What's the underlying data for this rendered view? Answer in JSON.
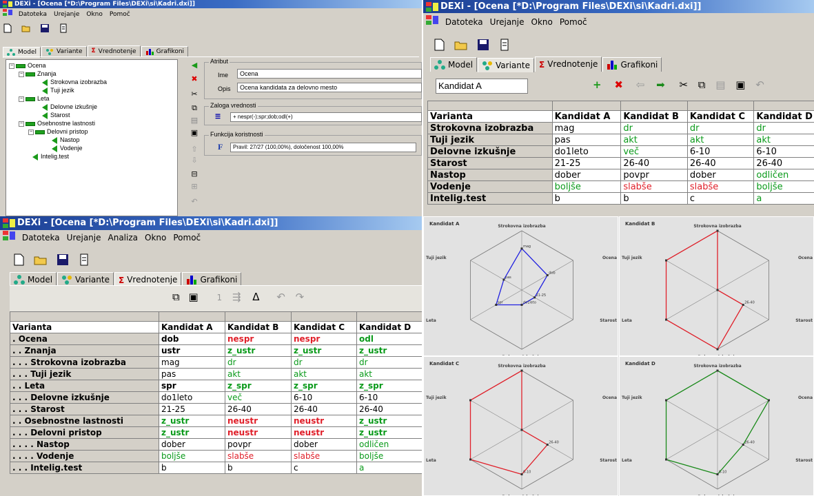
{
  "window_title_short": "DEXi - [Ocena [*D:\\Program Files\\DEXi\\si\\Kadri.dxi]]",
  "window_title": "DEXi - [Ocena [*D:\\Program Files\\DEXi\\si\\Kadri.dxi]]",
  "menus": {
    "basic": [
      "Datoteka",
      "Urejanje",
      "Okno",
      "Pomoč"
    ],
    "with_analysis": [
      "Datoteka",
      "Urejanje",
      "Analiza",
      "Okno",
      "Pomoč"
    ]
  },
  "tabs": [
    "Model",
    "Variante",
    "Vrednotenje",
    "Grafikoni"
  ],
  "model_window": {
    "tree": [
      {
        "label": "Ocena",
        "level": 0,
        "type": "aggregate",
        "expander": "−"
      },
      {
        "label": "Znanja",
        "level": 1,
        "type": "aggregate",
        "expander": "−"
      },
      {
        "label": "Strokovna izobrazba",
        "level": 2,
        "type": "basic"
      },
      {
        "label": "Tuji jezik",
        "level": 2,
        "type": "basic"
      },
      {
        "label": "Leta",
        "level": 1,
        "type": "aggregate",
        "expander": "−"
      },
      {
        "label": "Delovne izkušnje",
        "level": 2,
        "type": "basic"
      },
      {
        "label": "Starost",
        "level": 2,
        "type": "basic"
      },
      {
        "label": "Osebnostne lastnosti",
        "level": 1,
        "type": "aggregate",
        "expander": "−"
      },
      {
        "label": "Delovni pristop",
        "level": 2,
        "type": "aggregate",
        "expander": "−"
      },
      {
        "label": "Nastop",
        "level": 3,
        "type": "basic"
      },
      {
        "label": "Vodenje",
        "level": 3,
        "type": "basic"
      },
      {
        "label": "Intelig.test",
        "level": 1,
        "type": "basic"
      }
    ],
    "attribute_group": "Atribut",
    "name_label": "Ime",
    "name_value": "Ocena",
    "desc_label": "Opis",
    "desc_value": "Ocena kandidata za delovno mesto",
    "scale_group": "Zaloga vrednosti",
    "scale_value": "+ nespr(-);spr;dob;odl(+)",
    "function_group": "Funkcija koristnosti",
    "function_value": "Pravil: 27/27 (100,00%), določenost 100,00%",
    "function_icon": "F"
  },
  "variants_window": {
    "current_variant": "Kandidat A",
    "header": [
      "Varianta",
      "Kandidat A",
      "Kandidat B",
      "Kandidat C",
      "Kandidat D"
    ],
    "rows": [
      {
        "label": "Strokovna izobrazba",
        "cells": [
          [
            "mag",
            "black"
          ],
          [
            "dr",
            "green"
          ],
          [
            "dr",
            "green"
          ],
          [
            "dr",
            "green"
          ]
        ]
      },
      {
        "label": "Tuji jezik",
        "cells": [
          [
            "pas",
            "black"
          ],
          [
            "akt",
            "green"
          ],
          [
            "akt",
            "green"
          ],
          [
            "akt",
            "green"
          ]
        ]
      },
      {
        "label": "Delovne izkušnje",
        "cells": [
          [
            "do1leto",
            "black"
          ],
          [
            "več",
            "green"
          ],
          [
            "6-10",
            "black"
          ],
          [
            "6-10",
            "black"
          ]
        ]
      },
      {
        "label": "Starost",
        "cells": [
          [
            "21-25",
            "black"
          ],
          [
            "26-40",
            "black"
          ],
          [
            "26-40",
            "black"
          ],
          [
            "26-40",
            "black"
          ]
        ]
      },
      {
        "label": "Nastop",
        "cells": [
          [
            "dober",
            "black"
          ],
          [
            "povpr",
            "black"
          ],
          [
            "dober",
            "black"
          ],
          [
            "odličen",
            "green"
          ]
        ]
      },
      {
        "label": "Vodenje",
        "cells": [
          [
            "boljše",
            "green"
          ],
          [
            "slabše",
            "red"
          ],
          [
            "slabše",
            "red"
          ],
          [
            "boljše",
            "green"
          ]
        ]
      },
      {
        "label": "Intelig.test",
        "cells": [
          [
            "b",
            "black"
          ],
          [
            "b",
            "black"
          ],
          [
            "c",
            "black"
          ],
          [
            "a",
            "green"
          ]
        ]
      }
    ]
  },
  "evaluation_window": {
    "header": [
      "Varianta",
      "Kandidat A",
      "Kandidat B",
      "Kandidat C",
      "Kandidat D"
    ],
    "rows": [
      {
        "label": ". Ocena",
        "bold": true,
        "cells": [
          [
            "dob",
            "black"
          ],
          [
            "nespr",
            "red"
          ],
          [
            "nespr",
            "red"
          ],
          [
            "odl",
            "green"
          ]
        ]
      },
      {
        "label": ". . Znanja",
        "bold": true,
        "cells": [
          [
            "ustr",
            "black"
          ],
          [
            "z_ustr",
            "green"
          ],
          [
            "z_ustr",
            "green"
          ],
          [
            "z_ustr",
            "green"
          ]
        ]
      },
      {
        "label": ". . . Strokovna izobrazba",
        "bold": false,
        "cells": [
          [
            "mag",
            "black"
          ],
          [
            "dr",
            "green"
          ],
          [
            "dr",
            "green"
          ],
          [
            "dr",
            "green"
          ]
        ]
      },
      {
        "label": ". . . Tuji jezik",
        "bold": false,
        "cells": [
          [
            "pas",
            "black"
          ],
          [
            "akt",
            "green"
          ],
          [
            "akt",
            "green"
          ],
          [
            "akt",
            "green"
          ]
        ]
      },
      {
        "label": ". . Leta",
        "bold": true,
        "cells": [
          [
            "spr",
            "black"
          ],
          [
            "z_spr",
            "green"
          ],
          [
            "z_spr",
            "green"
          ],
          [
            "z_spr",
            "green"
          ]
        ]
      },
      {
        "label": ". . . Delovne izkušnje",
        "bold": false,
        "cells": [
          [
            "do1leto",
            "black"
          ],
          [
            "več",
            "green"
          ],
          [
            "6-10",
            "black"
          ],
          [
            "6-10",
            "black"
          ]
        ]
      },
      {
        "label": ". . . Starost",
        "bold": false,
        "cells": [
          [
            "21-25",
            "black"
          ],
          [
            "26-40",
            "black"
          ],
          [
            "26-40",
            "black"
          ],
          [
            "26-40",
            "black"
          ]
        ]
      },
      {
        "label": ". . Osebnostne lastnosti",
        "bold": true,
        "cells": [
          [
            "z_ustr",
            "green"
          ],
          [
            "neustr",
            "red"
          ],
          [
            "neustr",
            "red"
          ],
          [
            "z_ustr",
            "green"
          ]
        ]
      },
      {
        "label": ". . . Delovni pristop",
        "bold": true,
        "cells": [
          [
            "z_ustr",
            "green"
          ],
          [
            "neustr",
            "red"
          ],
          [
            "neustr",
            "red"
          ],
          [
            "z_ustr",
            "green"
          ]
        ]
      },
      {
        "label": ". . . . Nastop",
        "bold": false,
        "cells": [
          [
            "dober",
            "black"
          ],
          [
            "povpr",
            "black"
          ],
          [
            "dober",
            "black"
          ],
          [
            "odličen",
            "green"
          ]
        ]
      },
      {
        "label": ". . . . Vodenje",
        "bold": false,
        "cells": [
          [
            "boljše",
            "green"
          ],
          [
            "slabše",
            "red"
          ],
          [
            "slabše",
            "red"
          ],
          [
            "boljše",
            "green"
          ]
        ]
      },
      {
        "label": ". . . Intelig.test",
        "bold": false,
        "cells": [
          [
            "b",
            "black"
          ],
          [
            "b",
            "black"
          ],
          [
            "c",
            "black"
          ],
          [
            "a",
            "green"
          ]
        ]
      }
    ]
  },
  "colors": {
    "black": "#000000",
    "green": "#0a9a1a",
    "red": "#e0202a",
    "blue": "#2020e0",
    "title_bar": "#1c3f94"
  },
  "chart_data": [
    {
      "type": "radar",
      "title": "Kandidat A",
      "color": "#2020e0",
      "axes": [
        "Strokovna izobrazba",
        "Ocena",
        "Starost",
        "Delovne izkušnje",
        "Leta",
        "Tuji jezik"
      ],
      "values": [
        0.7,
        0.5,
        0.25,
        0.25,
        0.5,
        0.35
      ],
      "point_labels": [
        "mag",
        "dob",
        "21-25",
        "do1leto",
        "spr",
        "pas"
      ]
    },
    {
      "type": "radar",
      "title": "Kandidat B",
      "color": "#e0202a",
      "axes": [
        "Strokovna izobrazba",
        "Ocena",
        "Starost",
        "Delovne izkušnje",
        "Leta",
        "Tuji jezik"
      ],
      "values": [
        1.0,
        0.0,
        0.5,
        1.0,
        1.0,
        1.0
      ],
      "point_labels": [
        "",
        "",
        "26-40",
        "",
        "",
        ""
      ]
    },
    {
      "type": "radar",
      "title": "Kandidat C",
      "color": "#e0202a",
      "axes": [
        "Strokovna izobrazba",
        "Ocena",
        "Starost",
        "Delovne izkušnje",
        "Leta",
        "Tuji jezik"
      ],
      "values": [
        1.0,
        0.0,
        0.5,
        0.75,
        1.0,
        1.0
      ],
      "point_labels": [
        "",
        "",
        "26-40",
        "6-10",
        "",
        ""
      ]
    },
    {
      "type": "radar",
      "title": "Kandidat D",
      "color": "#1a8a1a",
      "axes": [
        "Strokovna izobrazba",
        "Ocena",
        "Starost",
        "Delovne izkušnje",
        "Leta",
        "Tuji jezik"
      ],
      "values": [
        1.0,
        1.0,
        0.5,
        0.75,
        1.0,
        1.0
      ],
      "point_labels": [
        "",
        "",
        "26-40",
        "6-10",
        "",
        ""
      ]
    }
  ]
}
